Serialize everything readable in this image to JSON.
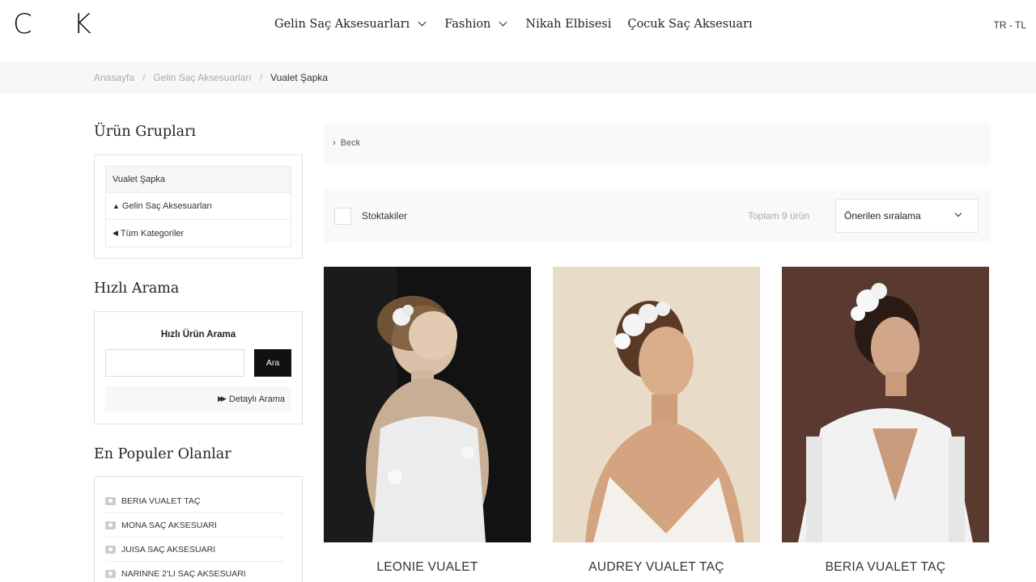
{
  "header": {
    "logo": "C K",
    "nav": [
      {
        "label": "Gelin Saç Aksesuarları",
        "dropdown": true
      },
      {
        "label": "Fashion",
        "dropdown": true
      },
      {
        "label": "Nikah Elbisesi",
        "dropdown": false
      },
      {
        "label": "Çocuk Saç Aksesuarı",
        "dropdown": false
      }
    ],
    "lang": "TR - TL"
  },
  "breadcrumb": [
    "Anasayfa",
    "Gelin Saç Aksesuarları",
    "Vualet Şapka"
  ],
  "sidebar": {
    "groups_title": "Ürün Grupları",
    "groups": [
      {
        "label": "Vualet Şapka",
        "prefix": ""
      },
      {
        "label": "Gelin Saç Aksesuarları",
        "prefix": "^"
      },
      {
        "label": "Tüm Kategoriler",
        "prefix": "<"
      }
    ],
    "quick_search_title": "Hızlı Arama",
    "quick_search": {
      "heading": "Hızlı Ürün Arama",
      "placeholder": "",
      "button": "Ara",
      "advanced": "Detaylı Arama"
    },
    "popular_title": "En Populer Olanlar",
    "popular": [
      "BERIA VUALET TAÇ",
      "MONA SAÇ AKSESUARI",
      "JUISA SAÇ AKSESUARI",
      "NARINNE 2'LI SAÇ AKSESUARI"
    ]
  },
  "main": {
    "back": "Beck",
    "stock_label": "Stoktakiler",
    "total": "Toplam 9 ürün",
    "sort": "Önerilen sıralama",
    "products": [
      {
        "name": "LEONIE VUALET",
        "bg": "#121212",
        "dress": "#eeeeee"
      },
      {
        "name": "AUDREY VUALET TAÇ",
        "bg": "#e8dcc8",
        "dress": "#f4f1ec"
      },
      {
        "name": "BERIA VUALET TAÇ",
        "bg": "#5a3a30",
        "dress": "#f2f2f2"
      }
    ]
  },
  "colors": {
    "accent": "#111111",
    "bar_bg": "#f7f7f7"
  }
}
